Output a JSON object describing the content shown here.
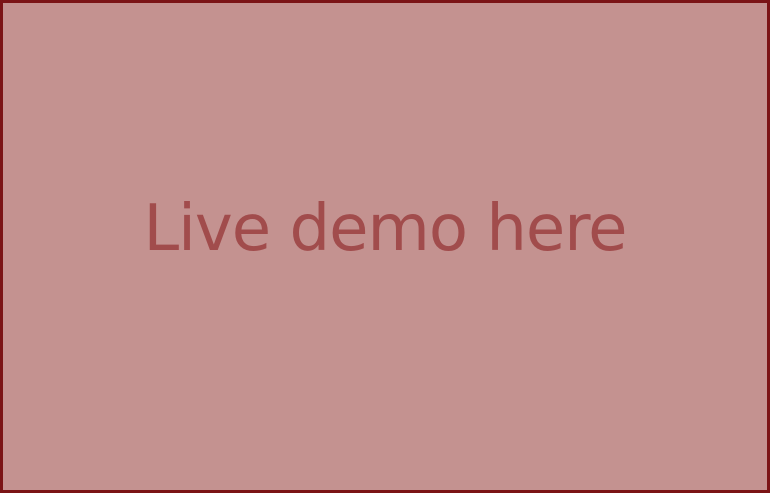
{
  "placeholder": {
    "label": "Live demo here"
  },
  "colors": {
    "background": "#c49290",
    "border": "#7b1416",
    "text": "#a14c4c"
  }
}
